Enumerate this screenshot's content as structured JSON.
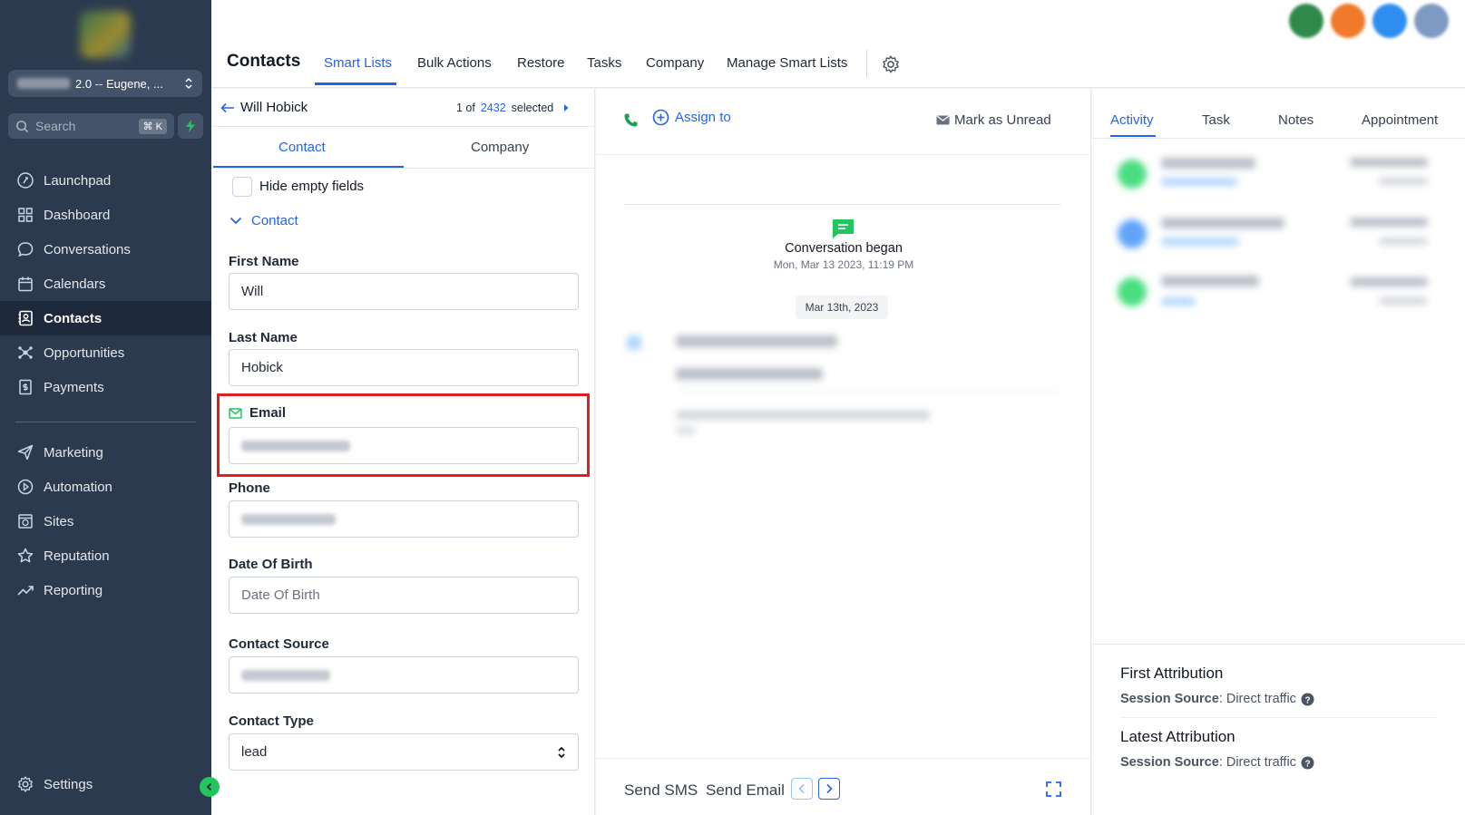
{
  "sidebar": {
    "account": {
      "label": "2.0 -- Eugene, ..."
    },
    "search": {
      "placeholder": "Search",
      "shortcut": "⌘ K"
    },
    "nav": [
      {
        "label": "Launchpad",
        "icon": "rocket-icon"
      },
      {
        "label": "Dashboard",
        "icon": "grid-icon"
      },
      {
        "label": "Conversations",
        "icon": "chat-icon"
      },
      {
        "label": "Calendars",
        "icon": "calendar-icon"
      },
      {
        "label": "Contacts",
        "icon": "contacts-icon",
        "active": true
      },
      {
        "label": "Opportunities",
        "icon": "opportunities-icon"
      },
      {
        "label": "Payments",
        "icon": "payments-icon"
      }
    ],
    "nav2": [
      {
        "label": "Marketing",
        "icon": "send-icon"
      },
      {
        "label": "Automation",
        "icon": "automation-icon"
      },
      {
        "label": "Sites",
        "icon": "sites-icon"
      },
      {
        "label": "Reputation",
        "icon": "star-icon"
      },
      {
        "label": "Reporting",
        "icon": "trend-icon"
      }
    ],
    "settings": {
      "label": "Settings"
    }
  },
  "topbar": {
    "title": "Contacts",
    "tabs": [
      {
        "label": "Smart Lists",
        "active": true
      },
      {
        "label": "Bulk Actions"
      },
      {
        "label": "Restore"
      },
      {
        "label": "Tasks"
      },
      {
        "label": "Company"
      },
      {
        "label": "Manage Smart Lists"
      }
    ]
  },
  "contact_panel": {
    "name": "Will Hobick",
    "counter": {
      "pre": "1 of",
      "total": "2432",
      "post": "selected"
    },
    "tabs": [
      {
        "label": "Contact",
        "active": true
      },
      {
        "label": "Company"
      }
    ],
    "hide_empty_label": "Hide empty fields",
    "section_label": "Contact",
    "fields": {
      "first_name": {
        "label": "First Name",
        "value": "Will"
      },
      "last_name": {
        "label": "Last Name",
        "value": "Hobick"
      },
      "email": {
        "label": "Email"
      },
      "phone": {
        "label": "Phone"
      },
      "dob": {
        "label": "Date Of Birth",
        "placeholder": "Date Of Birth"
      },
      "source": {
        "label": "Contact Source"
      },
      "type": {
        "label": "Contact Type",
        "value": "lead"
      }
    }
  },
  "conversation": {
    "assign_label": "Assign to",
    "mark_unread_label": "Mark as Unread",
    "began_title": "Conversation began",
    "began_time": "Mon, Mar 13 2023, 11:19 PM",
    "date_chip": "Mar 13th, 2023",
    "send_sms": "Send SMS",
    "send_email": "Send Email"
  },
  "activity_panel": {
    "tabs": [
      {
        "label": "Activity",
        "active": true
      },
      {
        "label": "Task"
      },
      {
        "label": "Notes"
      },
      {
        "label": "Appointment"
      }
    ],
    "first_attribution": {
      "title": "First Attribution",
      "key": "Session Source",
      "value": ": Direct traffic"
    },
    "latest_attribution": {
      "title": "Latest Attribution",
      "key": "Session Source",
      "value": ": Direct traffic"
    }
  },
  "colors": {
    "accent": "#2563eb",
    "sidebar": "#2c3a4f",
    "highlight": "#e11d1d",
    "success": "#22c55e"
  }
}
